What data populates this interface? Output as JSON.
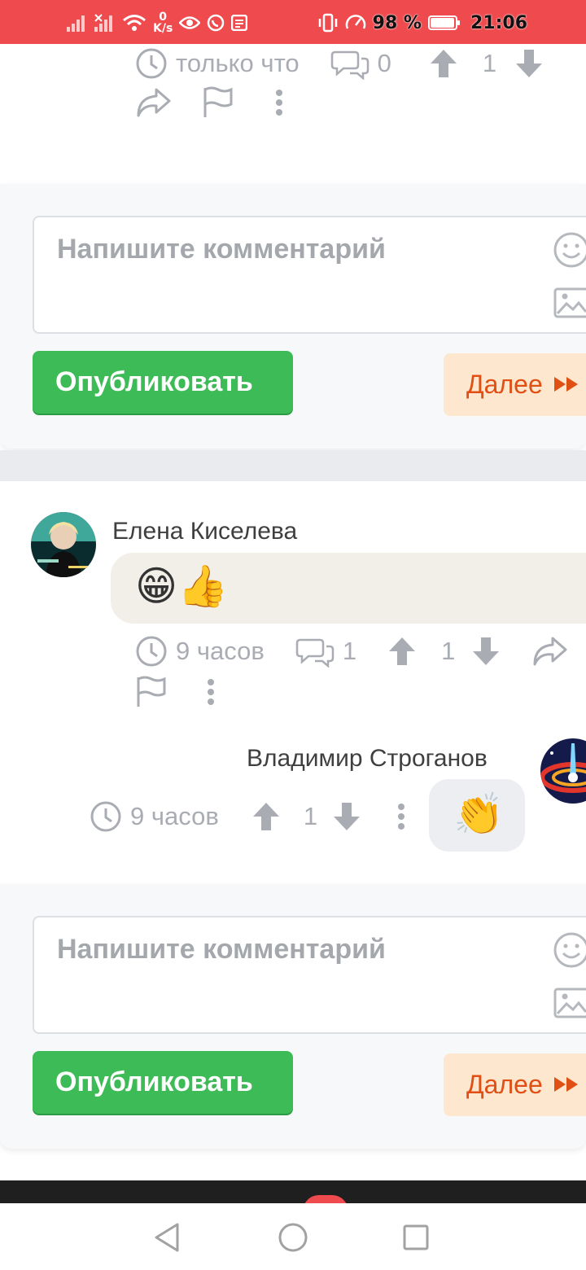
{
  "status_bar": {
    "speed_value": "0",
    "speed_unit": "K/s",
    "battery": "98 %",
    "time": "21:06",
    "battery_level": 0.98
  },
  "top_comment_meta": {
    "time": "только что",
    "replies": "0",
    "votes": "1"
  },
  "comment_form_1": {
    "placeholder": "Напишите комментарий",
    "publish_label": "Опубликовать",
    "next_label": "Далее"
  },
  "comment_1": {
    "author": "Елена Киселева",
    "emoji": "😁👍",
    "time": "9 часов",
    "replies": "1",
    "votes": "1"
  },
  "reply_1": {
    "author": "Владимир Строганов",
    "emoji": "👏",
    "time": "9 часов",
    "votes": "1"
  },
  "comment_form_2": {
    "placeholder": "Напишите комментарий",
    "publish_label": "Опубликовать",
    "next_label": "Далее"
  },
  "colors": {
    "status_bar": "#ef4b4f",
    "publish_button": "#3dbb57",
    "next_button_bg": "#fde7cf",
    "next_button_text": "#e04f14",
    "meta_gray": "#a9adb3"
  }
}
